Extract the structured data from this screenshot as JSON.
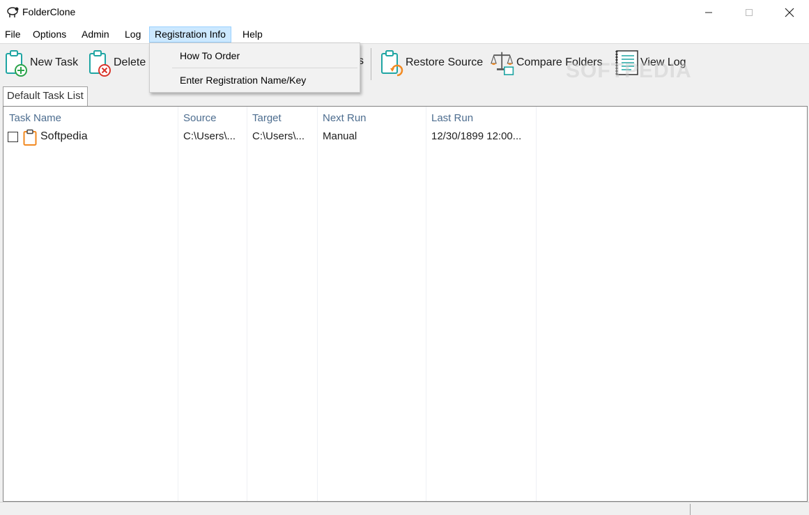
{
  "window": {
    "title": "FolderClone",
    "minimize_glyph": "—",
    "maximize_glyph": "☐",
    "close_glyph": "✕"
  },
  "menubar": {
    "items": [
      {
        "label": "File"
      },
      {
        "label": "Options"
      },
      {
        "label": "Admin"
      },
      {
        "label": "Log"
      },
      {
        "label": "Registration Info"
      },
      {
        "label": "Help"
      }
    ]
  },
  "toolbar": {
    "new_task": "New Task",
    "delete": "Delete",
    "partial_label": "s",
    "restore_source": "Restore Source",
    "compare_folders": "Compare Folders",
    "view_log": "View Log"
  },
  "dropdown": {
    "items": [
      {
        "label": "How To Order"
      },
      {
        "label": "Enter Registration Name/Key"
      }
    ]
  },
  "watermark": "SOFTPEDIA",
  "tabs": [
    {
      "label": "Default Task List"
    }
  ],
  "table": {
    "columns": [
      "Task Name",
      "Source",
      "Target",
      "Next Run",
      "Last Run"
    ],
    "rows": [
      {
        "task_name": "Softpedia",
        "source": "C:\\Users\\...",
        "target": "C:\\Users\\...",
        "next_run": "Manual",
        "last_run": "12/30/1899 12:00..."
      }
    ]
  },
  "colors": {
    "menu_highlight": "#cce8ff",
    "header_text": "#4d6d8f",
    "icon_teal": "#1fa5a3",
    "icon_orange": "#f28a22"
  }
}
